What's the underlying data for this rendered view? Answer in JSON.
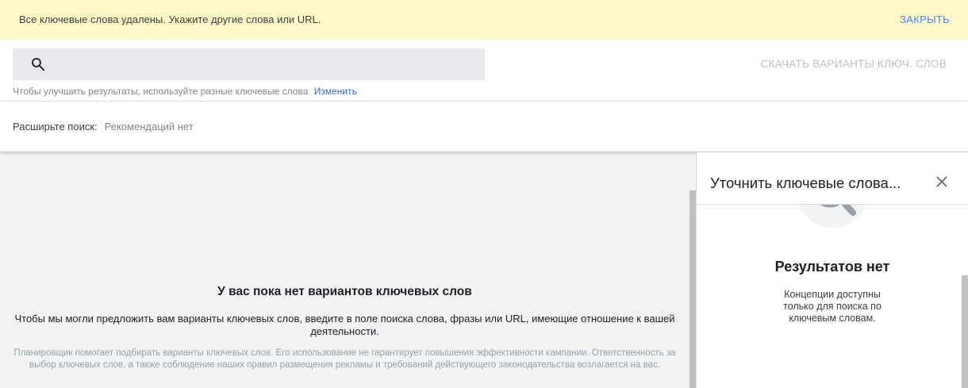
{
  "banner": {
    "message": "Все ключевые слова удалены. Укажите другие слова или URL.",
    "close_label": "ЗАКРЫТЬ",
    "background": "#fdf8c7",
    "accent": "#4285f4"
  },
  "search": {
    "icon": "search-icon",
    "value": "",
    "hint": "Чтобы улучшить результаты, используйте разные ключевые слова",
    "change_label": "Изменить",
    "download_label": "СКАЧАТЬ ВАРИАНТЫ КЛЮЧ. СЛОВ"
  },
  "expand": {
    "label": "Расширьте поиск:",
    "value": "Рекомендаций нет"
  },
  "main": {
    "empty_title": "У вас пока нет вариантов ключевых слов",
    "empty_description": "Чтобы мы могли предложить вам варианты ключевых слов, введите в поле поиска слова, фразы или URL, имеющие отношение к вашей деятельности.",
    "note": "Планировщик помогает подбирать варианты ключевых слов. Его использование не гарантирует повышения эффективности кампании. Ответственность за выбор ключевых слов, а также соблюдение наших правил размещения рекламы и требований действующего законодательства возлагается на вас."
  },
  "side_panel": {
    "title": "Уточнить ключевые слова...",
    "close_icon": "close-icon",
    "illustration": "magnifier-icon",
    "result_title": "Результатов нет",
    "result_text": "Концепции доступны только для поиска по ключевым словам."
  }
}
